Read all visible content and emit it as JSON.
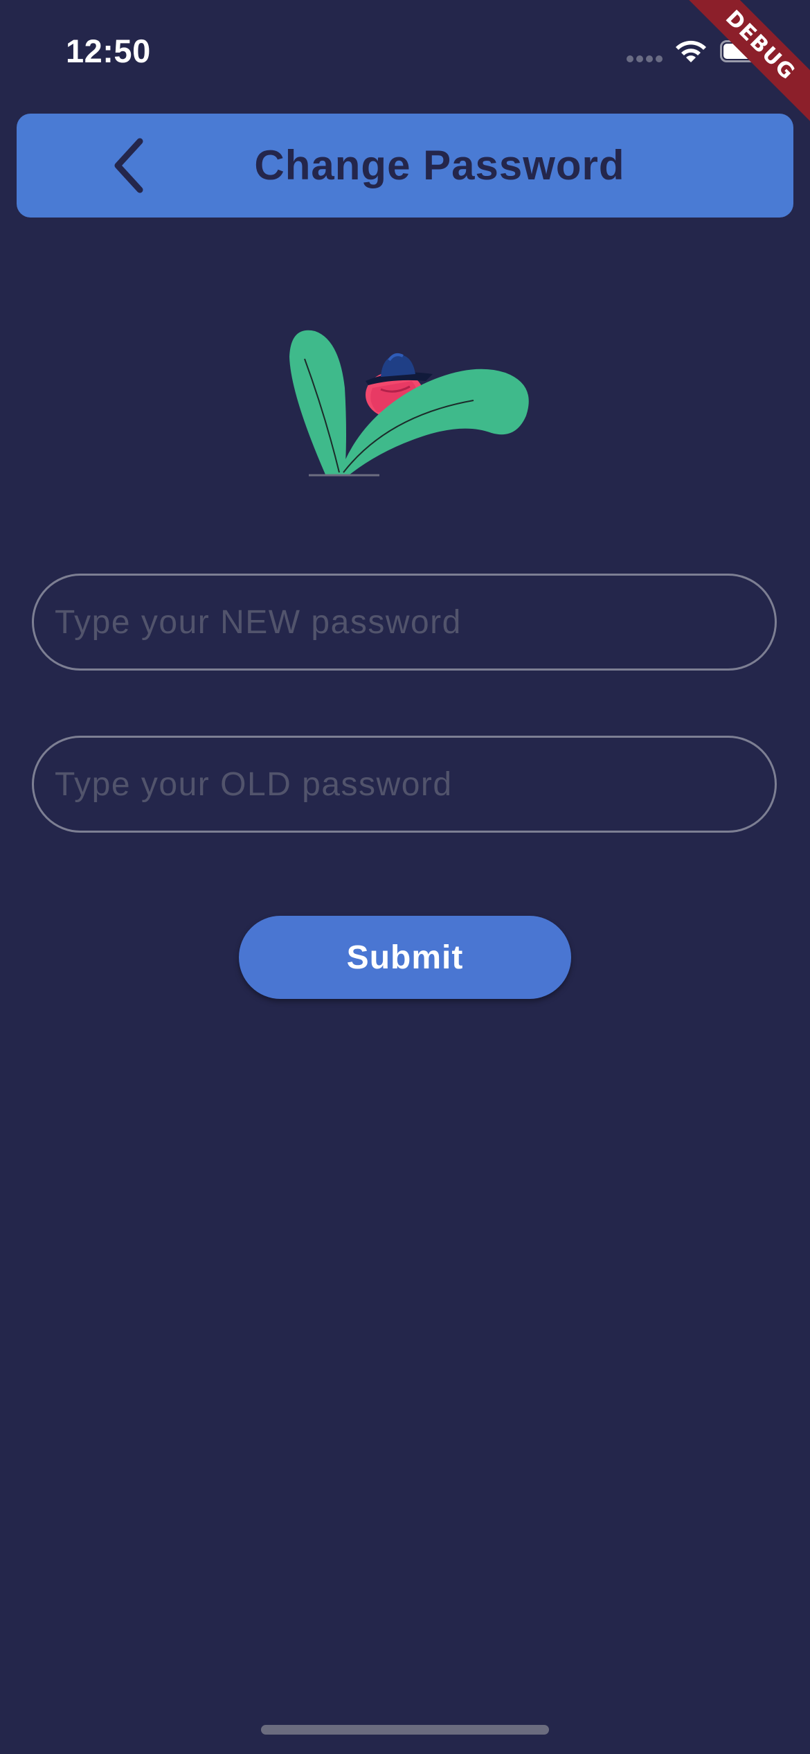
{
  "status_bar": {
    "time": "12:50",
    "signal_icon": "signal-dots-icon",
    "wifi_icon": "wifi-icon",
    "battery_icon": "battery-icon"
  },
  "debug_banner": {
    "label": "DEBUG",
    "color": "#8c1f2a"
  },
  "app_bar": {
    "title": "Change Password",
    "back_icon": "chevron-left-icon",
    "background": "#4a7bd4",
    "title_color": "#24264b"
  },
  "illustration": {
    "icon": "hiding-person-plant-illustration"
  },
  "form": {
    "new_password": {
      "placeholder": "Type your NEW password",
      "value": ""
    },
    "old_password": {
      "placeholder": "Type your OLD password",
      "value": ""
    },
    "submit_label": "Submit"
  },
  "colors": {
    "background": "#24264b",
    "accent": "#4a76d2",
    "field_border": "#7d7f93",
    "placeholder": "#52546c"
  }
}
